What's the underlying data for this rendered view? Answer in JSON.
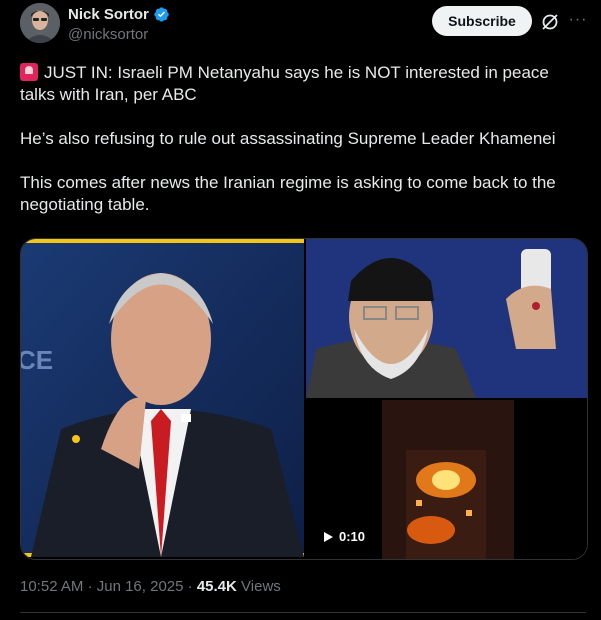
{
  "author": {
    "display_name": "Nick Sortor",
    "handle": "@nicksortor",
    "verified": true,
    "avatar_icon": "user-avatar"
  },
  "actions": {
    "subscribe_label": "Subscribe",
    "grok_icon": "grok-icon",
    "more_icon": "more-icon"
  },
  "tweet": {
    "line1": "JUST IN: Israeli PM Netanyahu says he is NOT interested in peace talks with Iran, per ABC",
    "line2": "He’s also refusing to rule out assassinating Supreme Leader Khamenei",
    "line3": "This comes after news the Iranian regime is asking to come back to the negotiating table.",
    "emoji_icon": "rotating-light-icon"
  },
  "media": {
    "video_duration": "0:10"
  },
  "meta": {
    "time": "10:52 AM",
    "separator": "·",
    "date": "Jun 16, 2025",
    "views_count": "45.4K",
    "views_label": "Views"
  },
  "colors": {
    "background": "#000000",
    "text": "#e7e9ea",
    "muted": "#71767b",
    "verified": "#1d9bf0",
    "accent_yellow": "#f5c518"
  }
}
